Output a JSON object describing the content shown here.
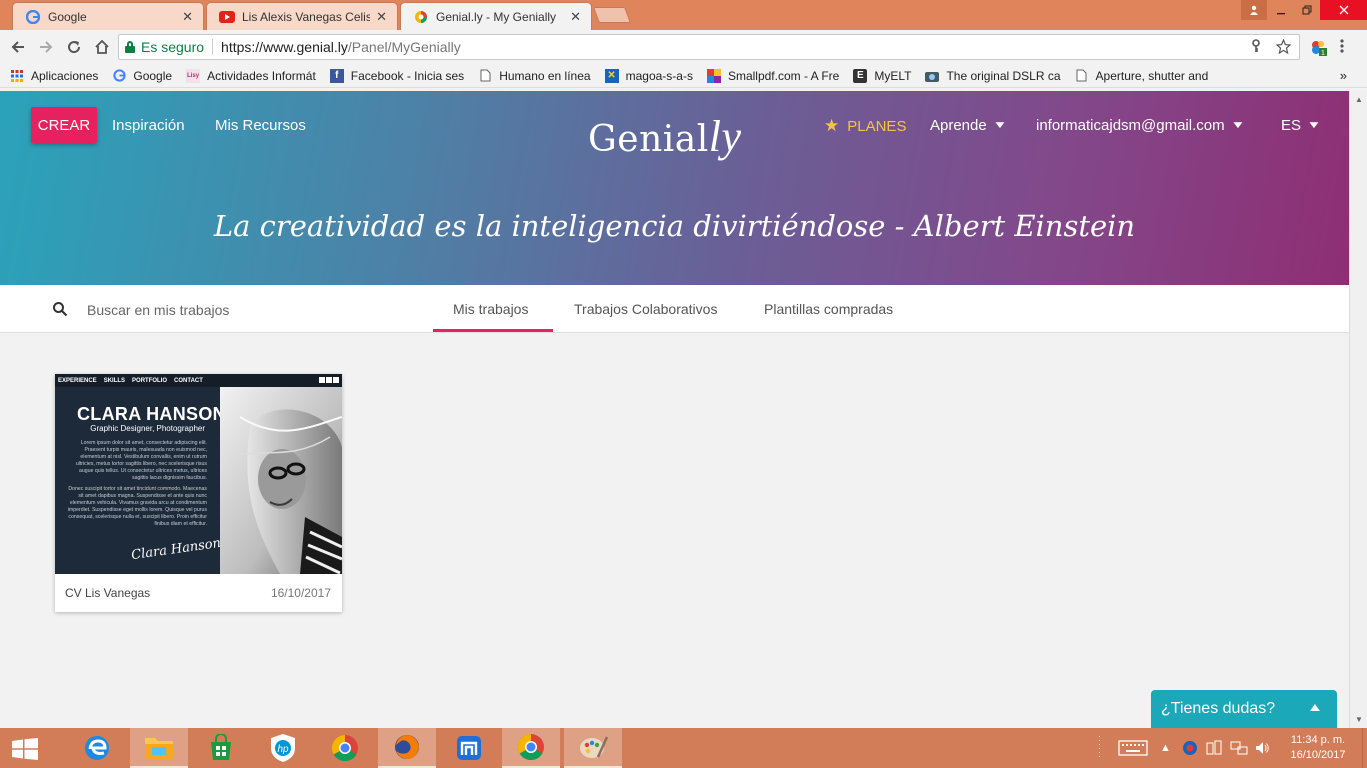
{
  "browser": {
    "tabs": [
      {
        "title": "Google",
        "icon": "google-icon"
      },
      {
        "title": "Lis Alexis Vanegas Celis -",
        "icon": "youtube-icon"
      },
      {
        "title": "Genial.ly - My Genially",
        "icon": "genially-icon"
      }
    ],
    "tab_close": "✕",
    "secure_label": "Es seguro",
    "url_host": "https://www.genial.ly",
    "url_path": "/Panel/MyGenially",
    "bookmarks": [
      {
        "label": "Aplicaciones",
        "icon": "apps-grid-icon"
      },
      {
        "label": "Google",
        "icon": "google-icon"
      },
      {
        "label": "Actividades Informát",
        "icon": "lisy-icon"
      },
      {
        "label": "Facebook - Inicia ses",
        "icon": "facebook-icon"
      },
      {
        "label": "Humano en línea",
        "icon": "page-icon"
      },
      {
        "label": "magoa-s-a-s",
        "icon": "magoa-icon"
      },
      {
        "label": "Smallpdf.com - A Fre",
        "icon": "smallpdf-icon"
      },
      {
        "label": "MyELT",
        "icon": "myelt-icon"
      },
      {
        "label": "The original DSLR ca",
        "icon": "camera-icon"
      },
      {
        "label": "Aperture, shutter and",
        "icon": "page-icon"
      }
    ],
    "bookmarks_more": "»"
  },
  "header": {
    "create_label": "CREAR",
    "inspiration_label": "Inspiración",
    "resources_label": "Mis Recursos",
    "logo_main": "Genial",
    "logo_script": "ly",
    "plans_label": "PLANES",
    "learn_label": "Aprende",
    "account_email": "informaticajdsm@gmail.com",
    "language": "ES",
    "quote": "La creatividad es la inteligencia divirtiéndose - Albert Einstein"
  },
  "panel": {
    "search_placeholder": "Buscar en mis trabajos",
    "tabs": [
      "Mis trabajos",
      "Trabajos Colaborativos",
      "Plantillas compradas"
    ],
    "active_tab": 0
  },
  "works": [
    {
      "title": "CV Lis Vanegas",
      "date": "16/10/2017",
      "thumbnail": {
        "nav": [
          "EXPERIENCE",
          "SKILLS",
          "PORTFOLIO",
          "CONTACT"
        ],
        "name": "CLARA HANSON",
        "role": "Graphic Designer, Photographer",
        "body": "Lorem ipsum dolor sit amet, consectetur adipiscing elit. Praesent turpis mauris, malesuada non euismod nec, elementum at nisl. Vestibulum convallis, enim ut rutrum ultricies, metus tortor sagittis libero, nec scelerisque risus augue quis tellus. Ut consectetur ultrices metus, ultrices sagittis lacus dignissim faucibus.",
        "body2": "Donec suscipit tortor sit amet tincidunt commodo. Maecenas sit amet dapibus magna. Suspendisse et ante quis nunc elementum vehicula. Vivamus gravida arcu at condimentum imperdiet. Suspendisse eget mollis lorem. Quisque vel purus consequat, scelerisque nulla et, suscipit libero. Proin efficitur finibus diam et efficitur.",
        "signature": "Clara Hanson"
      }
    }
  ],
  "help_widget": {
    "label": "¿Tienes dudas?"
  },
  "taskbar": {
    "time": "11:34 p. m.",
    "date": "16/10/2017",
    "apps": [
      "edge-icon",
      "file-explorer-icon",
      "store-icon",
      "hp-icon",
      "chrome-icon",
      "firefox-icon",
      "maxthon-icon",
      "chrome-icon",
      "paint-icon"
    ]
  },
  "colors": {
    "accent": "#e5215f",
    "planes": "#f6c443",
    "help": "#1ba8b8",
    "tab_strip": "#e0855b",
    "taskbar": "#d27d58"
  }
}
